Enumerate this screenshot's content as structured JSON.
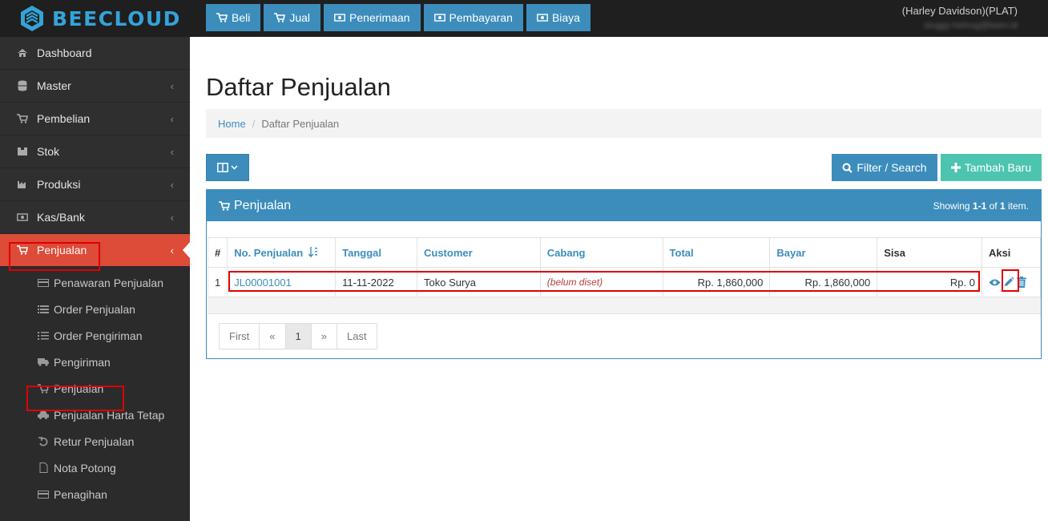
{
  "brand": {
    "name": "BEECLOUD"
  },
  "topnav": [
    {
      "label": "Beli",
      "icon": "cart-icon"
    },
    {
      "label": "Jual",
      "icon": "cart-icon"
    },
    {
      "label": "Penerimaan",
      "icon": "money-icon"
    },
    {
      "label": "Pembayaran",
      "icon": "money-icon"
    },
    {
      "label": "Biaya",
      "icon": "money-icon"
    }
  ],
  "user": {
    "name": "(Harley Davidson)(PLAT)",
    "email": "stuggy-hshrug@been.id"
  },
  "sidebar": {
    "items": [
      {
        "label": "Dashboard",
        "icon": "home-icon"
      },
      {
        "label": "Master",
        "icon": "database-icon"
      },
      {
        "label": "Pembelian",
        "icon": "cart-icon"
      },
      {
        "label": "Stok",
        "icon": "box-icon"
      },
      {
        "label": "Produksi",
        "icon": "industry-icon"
      },
      {
        "label": "Kas/Bank",
        "icon": "money-icon"
      },
      {
        "label": "Penjualan",
        "icon": "cart-icon"
      }
    ],
    "sub_items": [
      {
        "label": "Penawaran Penjualan",
        "icon": "card-icon"
      },
      {
        "label": "Order Penjualan",
        "icon": "list-icon"
      },
      {
        "label": "Order Pengiriman",
        "icon": "ordered-list-icon"
      },
      {
        "label": "Pengiriman",
        "icon": "truck-icon"
      },
      {
        "label": "Penjualan",
        "icon": "cart-icon"
      },
      {
        "label": "Penjualan Harta Tetap",
        "icon": "car-icon"
      },
      {
        "label": "Retur Penjualan",
        "icon": "undo-icon"
      },
      {
        "label": "Nota Potong",
        "icon": "file-icon"
      },
      {
        "label": "Penagihan",
        "icon": "card-icon"
      }
    ]
  },
  "page": {
    "title": "Daftar Penjualan",
    "breadcrumb": {
      "home": "Home",
      "current": "Daftar Penjualan"
    }
  },
  "toolbar": {
    "filter_label": "Filter / Search",
    "add_label": "Tambah Baru"
  },
  "panel": {
    "title": "Penjualan",
    "summary_prefix": "Showing ",
    "summary_range": "1-1",
    "summary_mid": " of ",
    "summary_total": "1",
    "summary_suffix": " item."
  },
  "table": {
    "headers": [
      "#",
      "No. Penjualan",
      "Tanggal",
      "Customer",
      "Cabang",
      "Total",
      "Bayar",
      "Sisa",
      "Aksi"
    ],
    "rows": [
      {
        "index": "1",
        "no": "JL00001001",
        "tanggal": "11-11-2022",
        "customer": "Toko Surya",
        "cabang": "(belum diset)",
        "total": "Rp. 1,860,000",
        "bayar": "Rp. 1,860,000",
        "sisa": "Rp. 0"
      }
    ]
  },
  "pagination": {
    "first": "First",
    "prev": "«",
    "current": "1",
    "next": "»",
    "last": "Last"
  },
  "colors": {
    "primary": "#3c8dbc",
    "active": "#dd4b39",
    "success": "#4cc4b0",
    "highlight": "#e00000"
  }
}
